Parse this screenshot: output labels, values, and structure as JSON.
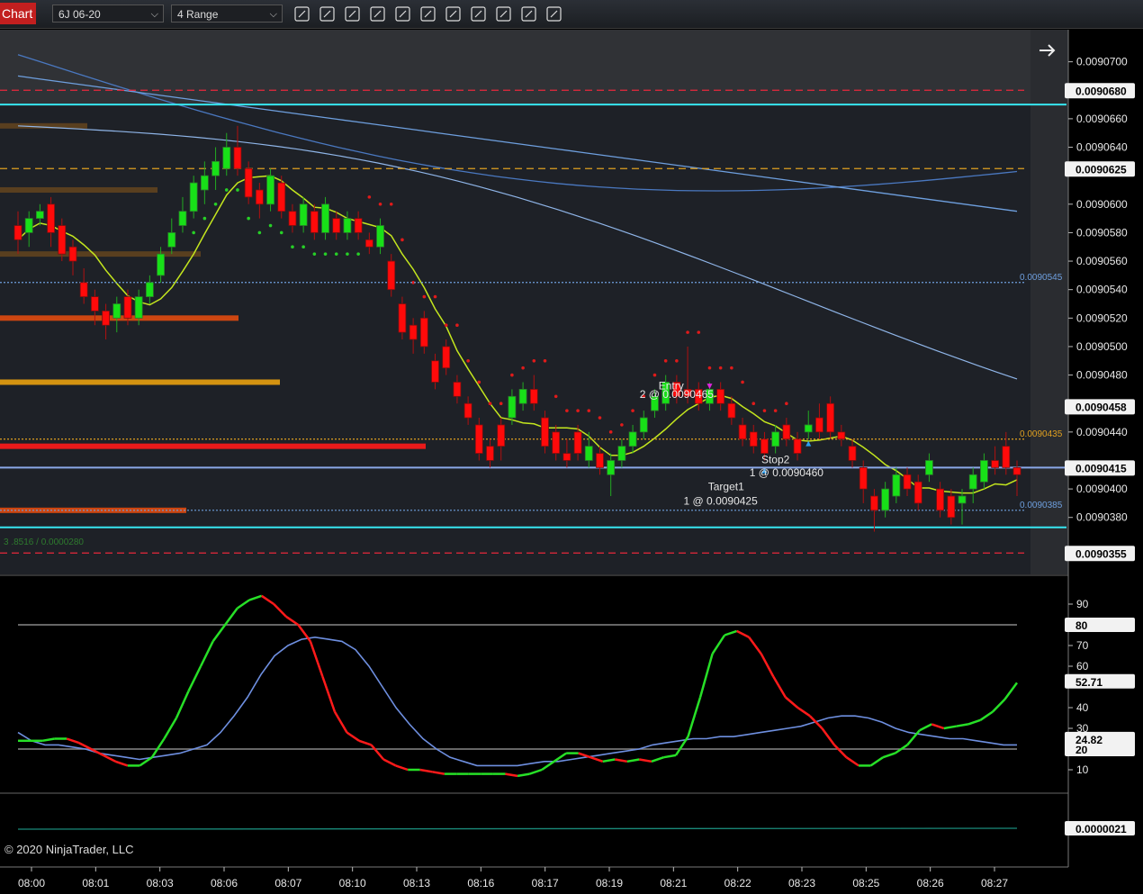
{
  "toolbar": {
    "tab_label": "Chart",
    "instrument": "6J 06-20",
    "bar_type": "4 Range",
    "icons": [
      "bar-style-icon",
      "draw-tool-icon",
      "zoom-in-icon",
      "zoom-out-icon",
      "crosshair-icon",
      "data-box-icon",
      "properties-icon",
      "indicators-icon",
      "strategies-icon",
      "templates-icon",
      "menu-icon"
    ]
  },
  "colors": {
    "background": "#1e2127",
    "bull_candle": "#18e018",
    "bear_candle": "#ff0a0a",
    "cyan_line": "#37e6f0",
    "red_dashed": "#e8283c",
    "orange_dashed": "#e0a020",
    "ma_yellow": "#c4e61e",
    "ma_blue": "#6e9fde",
    "stoch_blue": "#6e8fe0"
  },
  "chart_data": {
    "type": "candlestick",
    "price_axis_ticks": [
      "0.0090700",
      "0.0090660",
      "0.0090640",
      "0.0090600",
      "0.0090580",
      "0.0090560",
      "0.0090540",
      "0.0090520",
      "0.0090500",
      "0.0090480",
      "0.0090440",
      "0.0090400",
      "0.0090380"
    ],
    "price_labels": [
      {
        "value": 0.009068,
        "text": "0.0090680"
      },
      {
        "value": 0.0090625,
        "text": "0.0090625"
      },
      {
        "value": 0.0090458,
        "text": "0.0090458"
      },
      {
        "value": 0.0090415,
        "text": "0.0090415"
      },
      {
        "value": 0.0090355,
        "text": "0.0090355"
      }
    ],
    "line_labels": [
      {
        "value": 0.0090545,
        "text": "0.0090545",
        "color": "#6e9fde"
      },
      {
        "value": 0.0090435,
        "text": "0.0090435",
        "color": "#e0a020"
      },
      {
        "value": 0.0090385,
        "text": "0.0090385",
        "color": "#6e9fde"
      }
    ],
    "time_labels": [
      "08:00",
      "08:01",
      "08:03",
      "08:06",
      "08:07",
      "08:10",
      "08:13",
      "08:16",
      "08:17",
      "08:19",
      "08:21",
      "08:22",
      "08:23",
      "08:25",
      "08:26",
      "08:27"
    ],
    "candles": [
      [
        0.0090585,
        0.0090575,
        0.0090595,
        0.0090565
      ],
      [
        0.009058,
        0.009059,
        0.0090595,
        0.009057
      ],
      [
        0.009059,
        0.0090595,
        0.00906,
        0.0090585
      ],
      [
        0.00906,
        0.009058,
        0.0090605,
        0.009057
      ],
      [
        0.0090585,
        0.0090565,
        0.009059,
        0.009056
      ],
      [
        0.009057,
        0.009056,
        0.0090575,
        0.009055
      ],
      [
        0.0090545,
        0.0090535,
        0.0090555,
        0.009053
      ],
      [
        0.0090535,
        0.0090525,
        0.009054,
        0.0090515
      ],
      [
        0.0090525,
        0.0090515,
        0.009053,
        0.0090505
      ],
      [
        0.009052,
        0.009053,
        0.0090535,
        0.009051
      ],
      [
        0.0090535,
        0.009052,
        0.009054,
        0.0090515
      ],
      [
        0.009052,
        0.0090535,
        0.009054,
        0.0090515
      ],
      [
        0.0090535,
        0.0090545,
        0.009055,
        0.009053
      ],
      [
        0.009055,
        0.0090565,
        0.009057,
        0.0090545
      ],
      [
        0.009057,
        0.009058,
        0.009059,
        0.0090565
      ],
      [
        0.0090585,
        0.0090595,
        0.0090605,
        0.009058
      ],
      [
        0.0090595,
        0.0090615,
        0.009062,
        0.009059
      ],
      [
        0.009061,
        0.009062,
        0.009063,
        0.00906
      ],
      [
        0.009062,
        0.009063,
        0.009064,
        0.009061
      ],
      [
        0.0090625,
        0.009064,
        0.009065,
        0.009062
      ],
      [
        0.009064,
        0.0090625,
        0.0090655,
        0.009062
      ],
      [
        0.0090625,
        0.0090605,
        0.009063,
        0.00906
      ],
      [
        0.009061,
        0.00906,
        0.0090615,
        0.009059
      ],
      [
        0.00906,
        0.009062,
        0.0090625,
        0.0090595
      ],
      [
        0.0090615,
        0.0090595,
        0.009062,
        0.009059
      ],
      [
        0.0090595,
        0.0090585,
        0.00906,
        0.009058
      ],
      [
        0.0090585,
        0.00906,
        0.0090605,
        0.009058
      ],
      [
        0.0090595,
        0.009058,
        0.00906,
        0.0090575
      ],
      [
        0.009058,
        0.00906,
        0.0090605,
        0.0090575
      ],
      [
        0.009059,
        0.009058,
        0.0090595,
        0.0090575
      ],
      [
        0.009058,
        0.009059,
        0.0090595,
        0.0090575
      ],
      [
        0.009059,
        0.009058,
        0.0090595,
        0.0090575
      ],
      [
        0.0090575,
        0.009057,
        0.009058,
        0.0090565
      ],
      [
        0.009057,
        0.0090585,
        0.009059,
        0.0090565
      ],
      [
        0.009056,
        0.009054,
        0.0090565,
        0.0090535
      ],
      [
        0.009053,
        0.009051,
        0.0090535,
        0.0090505
      ],
      [
        0.0090515,
        0.0090505,
        0.009052,
        0.0090495
      ],
      [
        0.009052,
        0.00905,
        0.0090525,
        0.0090495
      ],
      [
        0.009049,
        0.0090475,
        0.0090495,
        0.009047
      ],
      [
        0.00905,
        0.0090485,
        0.0090505,
        0.009048
      ],
      [
        0.0090475,
        0.0090465,
        0.009048,
        0.009046
      ],
      [
        0.009046,
        0.009045,
        0.0090465,
        0.0090445
      ],
      [
        0.0090445,
        0.0090425,
        0.009045,
        0.009042
      ],
      [
        0.009043,
        0.009042,
        0.0090435,
        0.0090415
      ],
      [
        0.0090445,
        0.009043,
        0.009045,
        0.009042
      ],
      [
        0.009045,
        0.0090465,
        0.009047,
        0.0090445
      ],
      [
        0.009046,
        0.009047,
        0.0090475,
        0.0090455
      ],
      [
        0.009047,
        0.009046,
        0.009048,
        0.0090455
      ],
      [
        0.009045,
        0.009043,
        0.0090455,
        0.0090425
      ],
      [
        0.009044,
        0.0090425,
        0.0090445,
        0.009042
      ],
      [
        0.0090425,
        0.009042,
        0.0090435,
        0.0090415
      ],
      [
        0.009044,
        0.0090425,
        0.0090445,
        0.009042
      ],
      [
        0.009042,
        0.009043,
        0.009044,
        0.0090415
      ],
      [
        0.0090425,
        0.0090415,
        0.009043,
        0.009041
      ],
      [
        0.009041,
        0.009042,
        0.0090425,
        0.0090395
      ],
      [
        0.009042,
        0.009043,
        0.0090435,
        0.0090415
      ],
      [
        0.009043,
        0.009044,
        0.0090445,
        0.0090425
      ],
      [
        0.009044,
        0.009045,
        0.0090455,
        0.0090435
      ],
      [
        0.0090455,
        0.0090465,
        0.009047,
        0.009045
      ],
      [
        0.009046,
        0.0090475,
        0.009048,
        0.0090455
      ],
      [
        0.0090475,
        0.0090465,
        0.009048,
        0.009046
      ],
      [
        0.009047,
        0.0090465,
        0.00905,
        0.009046
      ],
      [
        0.009047,
        0.009046,
        0.0090475,
        0.0090455
      ],
      [
        0.009046,
        0.009047,
        0.0090475,
        0.0090455
      ],
      [
        0.009047,
        0.009046,
        0.0090475,
        0.0090455
      ],
      [
        0.009046,
        0.009045,
        0.0090465,
        0.0090445
      ],
      [
        0.0090445,
        0.0090435,
        0.009045,
        0.009043
      ],
      [
        0.009044,
        0.009043,
        0.0090445,
        0.0090425
      ],
      [
        0.0090435,
        0.0090425,
        0.009044,
        0.009042
      ],
      [
        0.009043,
        0.009044,
        0.0090445,
        0.0090425
      ],
      [
        0.0090445,
        0.0090435,
        0.009045,
        0.009043
      ],
      [
        0.0090435,
        0.0090425,
        0.009044,
        0.009042
      ],
      [
        0.009044,
        0.0090445,
        0.0090455,
        0.0090435
      ],
      [
        0.009045,
        0.009044,
        0.009046,
        0.0090435
      ],
      [
        0.009046,
        0.009044,
        0.0090465,
        0.0090435
      ],
      [
        0.009044,
        0.0090435,
        0.0090445,
        0.009043
      ],
      [
        0.009043,
        0.009042,
        0.0090435,
        0.0090415
      ],
      [
        0.0090415,
        0.00904,
        0.009042,
        0.009039
      ],
      [
        0.0090395,
        0.0090385,
        0.00904,
        0.009037
      ],
      [
        0.0090385,
        0.00904,
        0.0090405,
        0.009038
      ],
      [
        0.0090395,
        0.009041,
        0.0090415,
        0.009039
      ],
      [
        0.009041,
        0.00904,
        0.0090415,
        0.0090395
      ],
      [
        0.0090405,
        0.009039,
        0.009041,
        0.0090385
      ],
      [
        0.009041,
        0.009042,
        0.0090425,
        0.0090405
      ],
      [
        0.00904,
        0.0090385,
        0.0090405,
        0.009038
      ],
      [
        0.0090395,
        0.009038,
        0.00904,
        0.0090375
      ],
      [
        0.009039,
        0.0090395,
        0.00904,
        0.0090375
      ],
      [
        0.00904,
        0.009041,
        0.0090415,
        0.009039
      ],
      [
        0.0090405,
        0.009042,
        0.0090425,
        0.00904
      ],
      [
        0.009042,
        0.0090415,
        0.009043,
        0.009041
      ],
      [
        0.009043,
        0.0090415,
        0.009044,
        0.009041
      ],
      [
        0.0090415,
        0.009041,
        0.009042,
        0.0090395
      ]
    ],
    "horizontal_lines": [
      {
        "value": 0.009068,
        "style": "dashed",
        "color": "#e8283c"
      },
      {
        "value": 0.009067,
        "style": "solid",
        "color": "#37e6f0"
      },
      {
        "value": 0.0090625,
        "style": "dashed",
        "color": "#e0a020"
      },
      {
        "value": 0.0090545,
        "style": "dotted",
        "color": "#6e9fde"
      },
      {
        "value": 0.0090435,
        "style": "dotted",
        "color": "#e0a020"
      },
      {
        "value": 0.0090415,
        "style": "solid",
        "color": "#8aa8e8"
      },
      {
        "value": 0.0090385,
        "style": "dotted",
        "color": "#6e9fde"
      },
      {
        "value": 0.0090373,
        "style": "solid",
        "color": "#37e6f0"
      },
      {
        "value": 0.0090355,
        "style": "dashed",
        "color": "#e8283c"
      }
    ],
    "annotations": [
      {
        "text": "Entry",
        "time_index": 59.5,
        "value": 0.009047
      },
      {
        "text": "2 @ 0.0090465",
        "time_index": 60,
        "value": 0.0090464
      },
      {
        "text": "Stop2",
        "time_index": 69,
        "value": 0.0090418
      },
      {
        "text": "1 @ 0.0090460",
        "time_index": 70,
        "value": 0.0090409
      },
      {
        "text": "Target1",
        "time_index": 64.5,
        "value": 0.0090399
      },
      {
        "text": "1 @ 0.0090425",
        "time_index": 64,
        "value": 0.0090389
      }
    ],
    "profile_note": "3 .8516 / 0.0000280",
    "stochastics": {
      "axis_ticks": [
        "90",
        "70",
        "60",
        "40",
        "30",
        "10"
      ],
      "overbought": 80,
      "oversold": 20,
      "current_k": "52.71",
      "current_d": "24.82",
      "k": [
        24,
        24,
        24,
        25,
        25,
        23,
        20,
        17,
        14,
        12,
        12,
        16,
        25,
        35,
        48,
        60,
        72,
        80,
        88,
        92,
        94,
        90,
        84,
        80,
        72,
        55,
        38,
        28,
        24,
        22,
        15,
        12,
        10,
        10,
        9,
        8,
        8,
        8,
        8,
        8,
        8,
        7,
        8,
        10,
        14,
        18,
        18,
        16,
        14,
        15,
        14,
        15,
        14,
        16,
        17,
        26,
        45,
        66,
        75,
        77,
        74,
        66,
        55,
        45,
        40,
        36,
        30,
        22,
        16,
        12,
        12,
        16,
        18,
        22,
        29,
        32,
        30,
        31,
        32,
        34,
        38,
        44,
        52
      ],
      "d": [
        28,
        24,
        22,
        22,
        21,
        20,
        18,
        17,
        16,
        15,
        16,
        17,
        18,
        20,
        22,
        28,
        36,
        45,
        56,
        65,
        70,
        73,
        74,
        73,
        72,
        68,
        60,
        50,
        40,
        32,
        25,
        20,
        16,
        14,
        12,
        12,
        12,
        12,
        13,
        14,
        14,
        15,
        16,
        17,
        18,
        19,
        20,
        22,
        23,
        24,
        25,
        25,
        26,
        26,
        27,
        28,
        29,
        30,
        31,
        33,
        35,
        36,
        36,
        35,
        33,
        30,
        28,
        27,
        26,
        25,
        25,
        24,
        23,
        22,
        22
      ]
    },
    "lower_panel": {
      "label": "0.0000021"
    },
    "copyright": "© 2020 NinjaTrader, LLC"
  }
}
